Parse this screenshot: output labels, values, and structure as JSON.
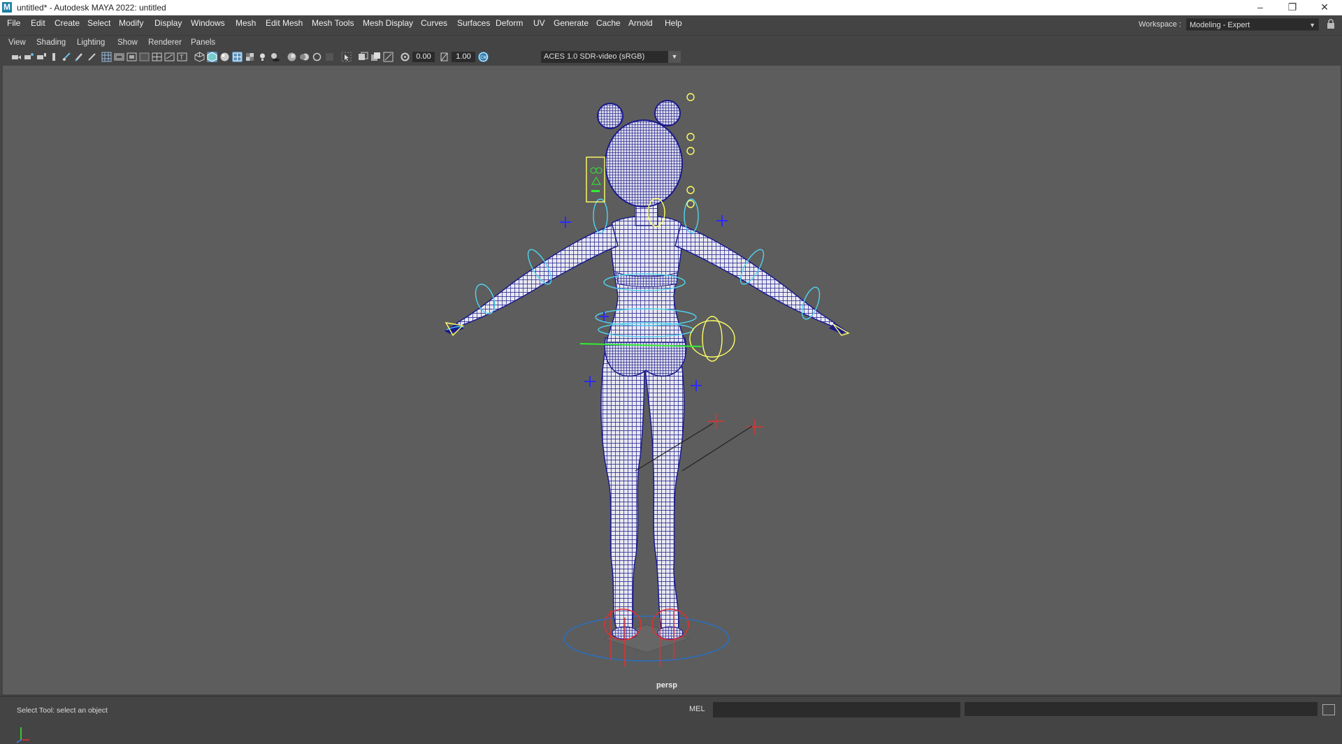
{
  "window": {
    "title": "untitled* - Autodesk MAYA 2022: untitled",
    "logo": "M",
    "minimize": "–",
    "restore": "❐",
    "close": "✕"
  },
  "menu": [
    "File",
    "Edit",
    "Create",
    "Select",
    "Modify",
    "Display",
    "Windows",
    "Mesh",
    "Edit Mesh",
    "Mesh Tools",
    "Mesh Display",
    "Curves",
    "Surfaces",
    "Deform",
    "UV",
    "Generate",
    "Cache",
    "Arnold",
    "Help"
  ],
  "workspace": {
    "label": "Workspace :",
    "value": "Modeling - Expert"
  },
  "panel_menu": [
    "View",
    "Shading",
    "Lighting",
    "Show",
    "Renderer",
    "Panels"
  ],
  "toolbar": {
    "exposure": "0.00",
    "gamma": "1.00",
    "color_management": "ACES 1.0 SDR-video (sRGB)"
  },
  "viewport": {
    "camera": "persp",
    "background": "#5d5d5d",
    "wire_color": "#1a1a8c",
    "control_cyan": "#4fd4f0",
    "control_yellow": "#ffff66",
    "control_red": "#e23030",
    "control_green": "#33ee33"
  },
  "status": {
    "help_line": "Select Tool: select an object",
    "script_language": "MEL"
  }
}
